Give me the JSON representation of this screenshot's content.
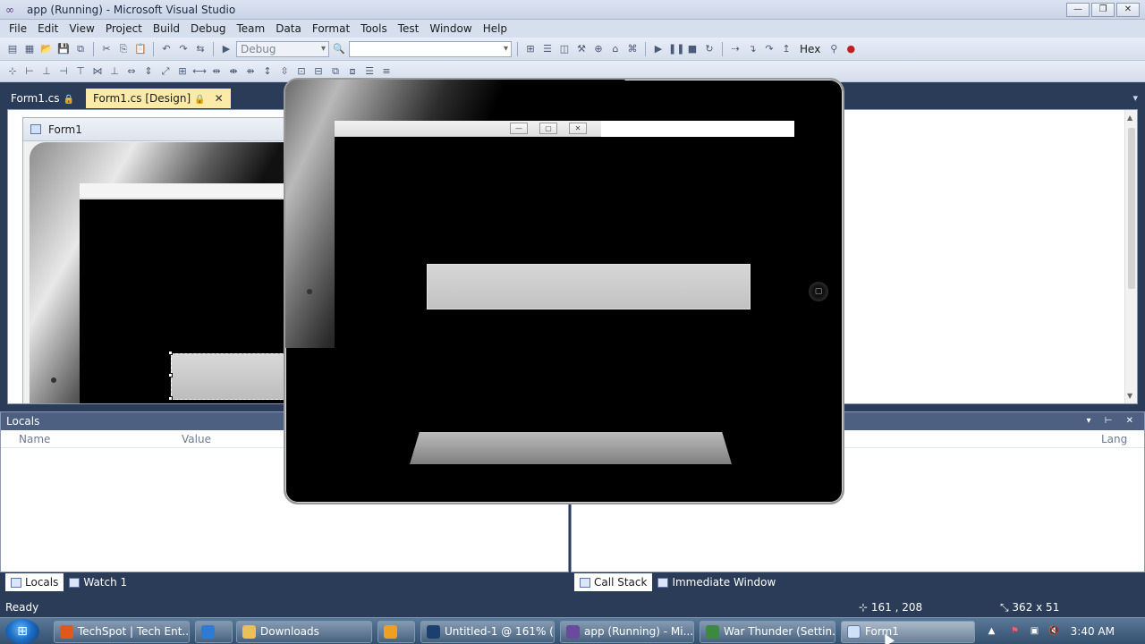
{
  "window": {
    "title": "app (Running) - Microsoft Visual Studio"
  },
  "menu": [
    "File",
    "Edit",
    "View",
    "Project",
    "Build",
    "Debug",
    "Team",
    "Data",
    "Format",
    "Tools",
    "Test",
    "Window",
    "Help"
  ],
  "toolbar": {
    "config": "Debug",
    "platform": "",
    "hex_label": "Hex"
  },
  "doc_tabs": {
    "code": "Form1.cs",
    "design": "Form1.cs [Design]"
  },
  "designer": {
    "form_caption": "Form1"
  },
  "locals": {
    "title": "Locals",
    "columns": {
      "name": "Name",
      "value": "Value"
    },
    "tabs": [
      "Locals",
      "Watch 1"
    ]
  },
  "callstack": {
    "columns": {
      "lang": "Lang"
    },
    "tabs": [
      "Call Stack",
      "Immediate Window"
    ]
  },
  "status": {
    "ready": "Ready",
    "position": "161 , 208",
    "size": "362 x 51"
  },
  "taskbar": {
    "tasks": [
      "TechSpot | Tech Ent...",
      "",
      "Downloads",
      "",
      "Untitled-1 @ 161% (...",
      "app (Running) - Mi...",
      "War Thunder (Settin...",
      "Form1"
    ],
    "clock": "3:40 AM"
  },
  "colors": {
    "accent": "#2b3c59",
    "active_tab": "#fceaa8",
    "panel_head": "#4d6082"
  }
}
